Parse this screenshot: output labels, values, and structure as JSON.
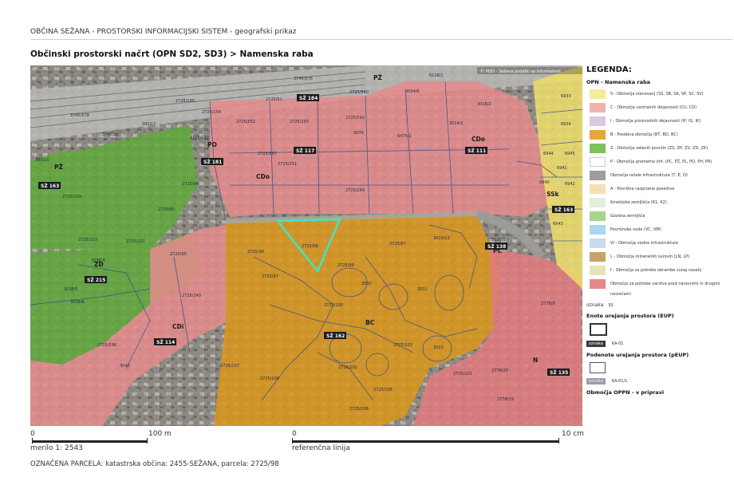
{
  "header": {
    "app_title": "OBČINA SEŽANA - PROSTORSKI INFORMACIJSKI SISTEM - geografski prikaz"
  },
  "map_title": "Občinski prostorski načrt (OPN SD2, SD3) > Namenska raba",
  "map": {
    "copyright": "© PISO - Sežana podatki so informativni",
    "zone_labels": [
      "PŽ",
      "PO",
      "CDo",
      "CDo",
      "CDi",
      "ZD",
      "PŽ",
      "BC",
      "PC",
      "N",
      "SSk"
    ],
    "badges": [
      "SŽ 184",
      "SŽ 181",
      "SŽ 117",
      "SŽ 111",
      "SŽ 163",
      "SŽ 215",
      "SŽ 114",
      "SŽ 162",
      "SŽ 138",
      "SŽ 135",
      "SŽ 163"
    ],
    "parcels": [
      "3745/576",
      "3745/578",
      "3952/1",
      "3745/20",
      "3951/1",
      "2725/159",
      "2725/185",
      "2725/51",
      "2725/154",
      "2725/193",
      "2725/552",
      "2725/250",
      "2725/542",
      "2725/540",
      "3004/6",
      "6118/1",
      "3018/2",
      "3014/1",
      "6874",
      "6475/1",
      "2725/557",
      "2725/251",
      "2725/254",
      "2725/94",
      "2725/90",
      "2725/223",
      "2725/127",
      "2725/95",
      "2725/96",
      "2725/97",
      "2725/98",
      "2725/99",
      "2725/87",
      "3010/12",
      "3032",
      "3031",
      "3021/1",
      "2725/100",
      "2725/240",
      "3038/4",
      "3038/5",
      "3038/6",
      "2725/296",
      "3042",
      "2725/107",
      "2725/108",
      "2725/102",
      "2725/105",
      "2725/106",
      "3023",
      "2725/103",
      "2725/101",
      "2778/9",
      "2778/20",
      "2778/19",
      "6933",
      "6934",
      "6944",
      "6945",
      "6941",
      "6940",
      "6942",
      "6943"
    ]
  },
  "scale": {
    "left_zero": "0",
    "left_end": "100 m",
    "ratio_label": "merilo 1: 2543",
    "right_zero": "0",
    "right_end": "10 cm",
    "ref_label": "referenčna linija"
  },
  "parcel_info": "OZNAČENA PARCELA: katastrska občina: 2455-SEŽANA, parcela: 2725/98",
  "legend": {
    "title": "LEGENDA:",
    "section_title": "OPN - Namenska raba",
    "items": [
      {
        "label": "S - Območja stanovanj (SS, SB, SK, SP, SC, SV)",
        "color": "#f5ec9c"
      },
      {
        "label": "C - Območja centralnih dejavnosti (CU, CD)",
        "color": "#f1b4ad"
      },
      {
        "label": "I - Območja proizvodnih dejavnosti (IP, IG, IK)",
        "color": "#d9c9e3"
      },
      {
        "label": "B - Posebna območja (BT, BD, BC)",
        "color": "#e6a63c"
      },
      {
        "label": "Z - Območja zelenih površin (ZS, ZP, ZV, ZD, ZK)",
        "color": "#7cc35a"
      },
      {
        "label": "P - Območja prometne infr. (PC, PŽ, PL, PO, PH, PR)",
        "color": "#ffffff"
      },
      {
        "label": "Območja ostale infrastrukture (T, E, O)",
        "color": "#9d9d9d"
      },
      {
        "label": "A - Površine razpršene poselitve",
        "color": "#f7dfb5"
      },
      {
        "label": "Kmetijska zemljišča (K1, K2)",
        "color": "#e3efd9"
      },
      {
        "label": "Gozdna zemljišča",
        "color": "#a6d48c"
      },
      {
        "label": "Površinske vode (VC, VM)",
        "color": "#a9d6f2"
      },
      {
        "label": "VI - Območja vodne infrastrukture",
        "color": "#c7dced"
      },
      {
        "label": "L - Območja mineralnih surovin (LN, LP)",
        "color": "#c9a268"
      },
      {
        "label": "f - Območja za potrebe obrambe zunaj naselij",
        "color": "#e9e4b3"
      },
      {
        "label": "Območja za potrebe varstva pred naravnimi in drugimi nesrečami",
        "color": "#e8878a"
      }
    ],
    "oznaka_label": "oznaka",
    "oznaka_value": "SS",
    "eup_title": "Enote urejanja prostora (EUP)",
    "eup_chip": "oznaka",
    "eup_code": "KA-01",
    "peup_title": "Podenote urejanja prostora (pEUP)",
    "peup_chip": "oznaka",
    "peup_code": "KA-01/1",
    "oppn_title": "Območja OPPN - v pripravi"
  },
  "colors": {
    "selected_parcel": "#3ee6c4",
    "zone_orange": "#d8961f",
    "zone_pink": "#e58b8b",
    "zone_green": "#5fa83b",
    "zone_yellow": "#ecdc6c",
    "badge_bg": "#1b1b1b"
  }
}
